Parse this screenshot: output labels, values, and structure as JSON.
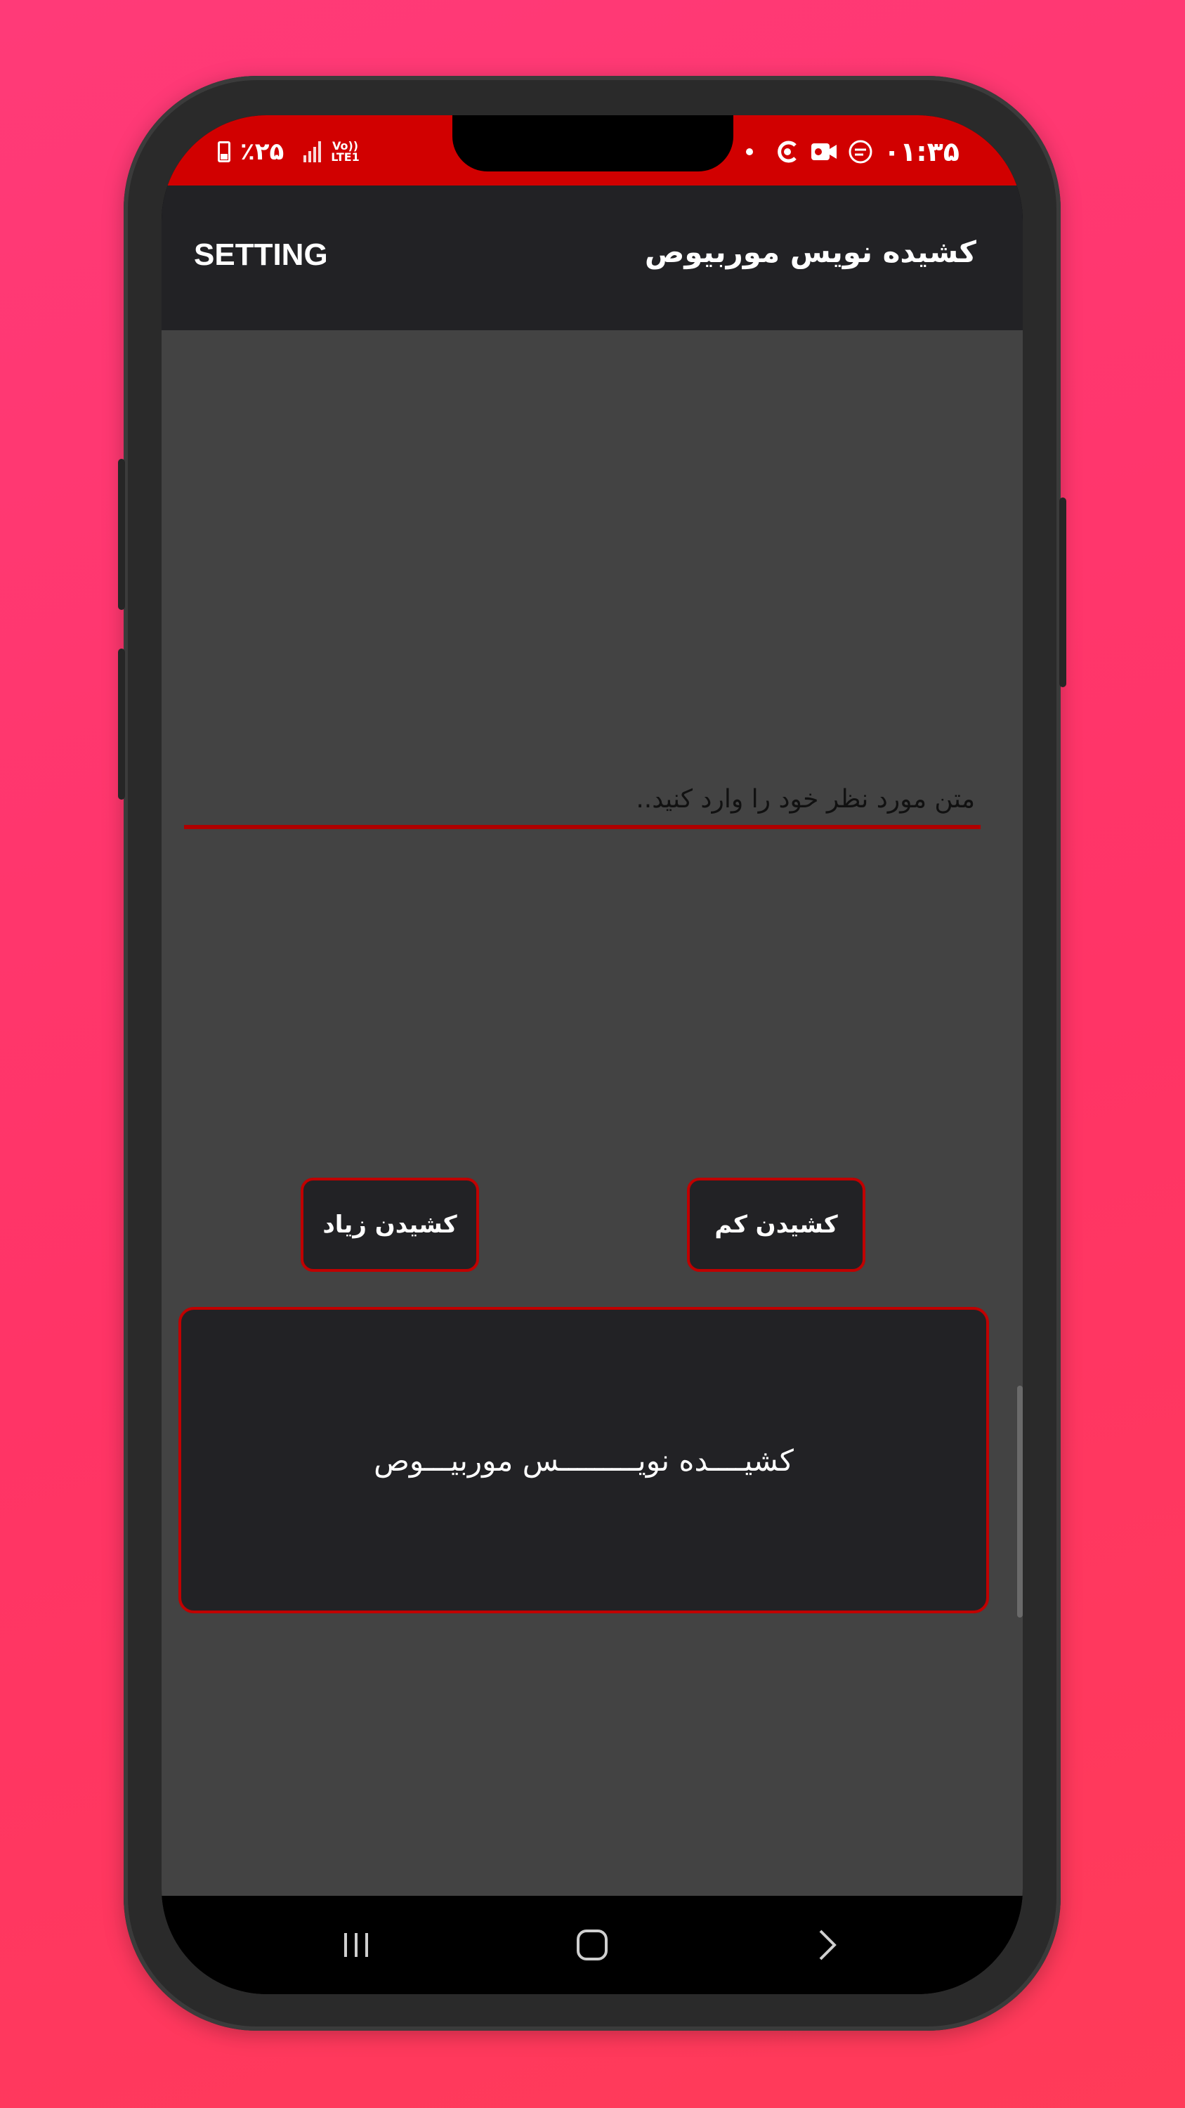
{
  "status_bar": {
    "time": "۰۱:۳۵",
    "battery_percent": "٪۲۵",
    "network_top": "Vo))",
    "network_bottom": "LTE1",
    "background_color": "#d10000"
  },
  "app_bar": {
    "setting_label": "SETTING",
    "title": "کشیده نویس موربیوص"
  },
  "input": {
    "placeholder": "متن مورد نظر خود را وارد کنید..",
    "value": ""
  },
  "buttons": {
    "stretch_less": "کشیدن کم",
    "stretch_more": "کشیدن زیاد"
  },
  "output": {
    "text": "کشیــــده نویـــــــــس موربیـــوص"
  },
  "nav_bar": {
    "recents_icon": "recents-icon",
    "home_icon": "home-icon",
    "back_icon": "back-chevron-icon"
  },
  "colors": {
    "accent": "#c00000",
    "dark_surface": "#222225",
    "content_bg": "#434343",
    "page_bg": "#ff3a6c"
  }
}
